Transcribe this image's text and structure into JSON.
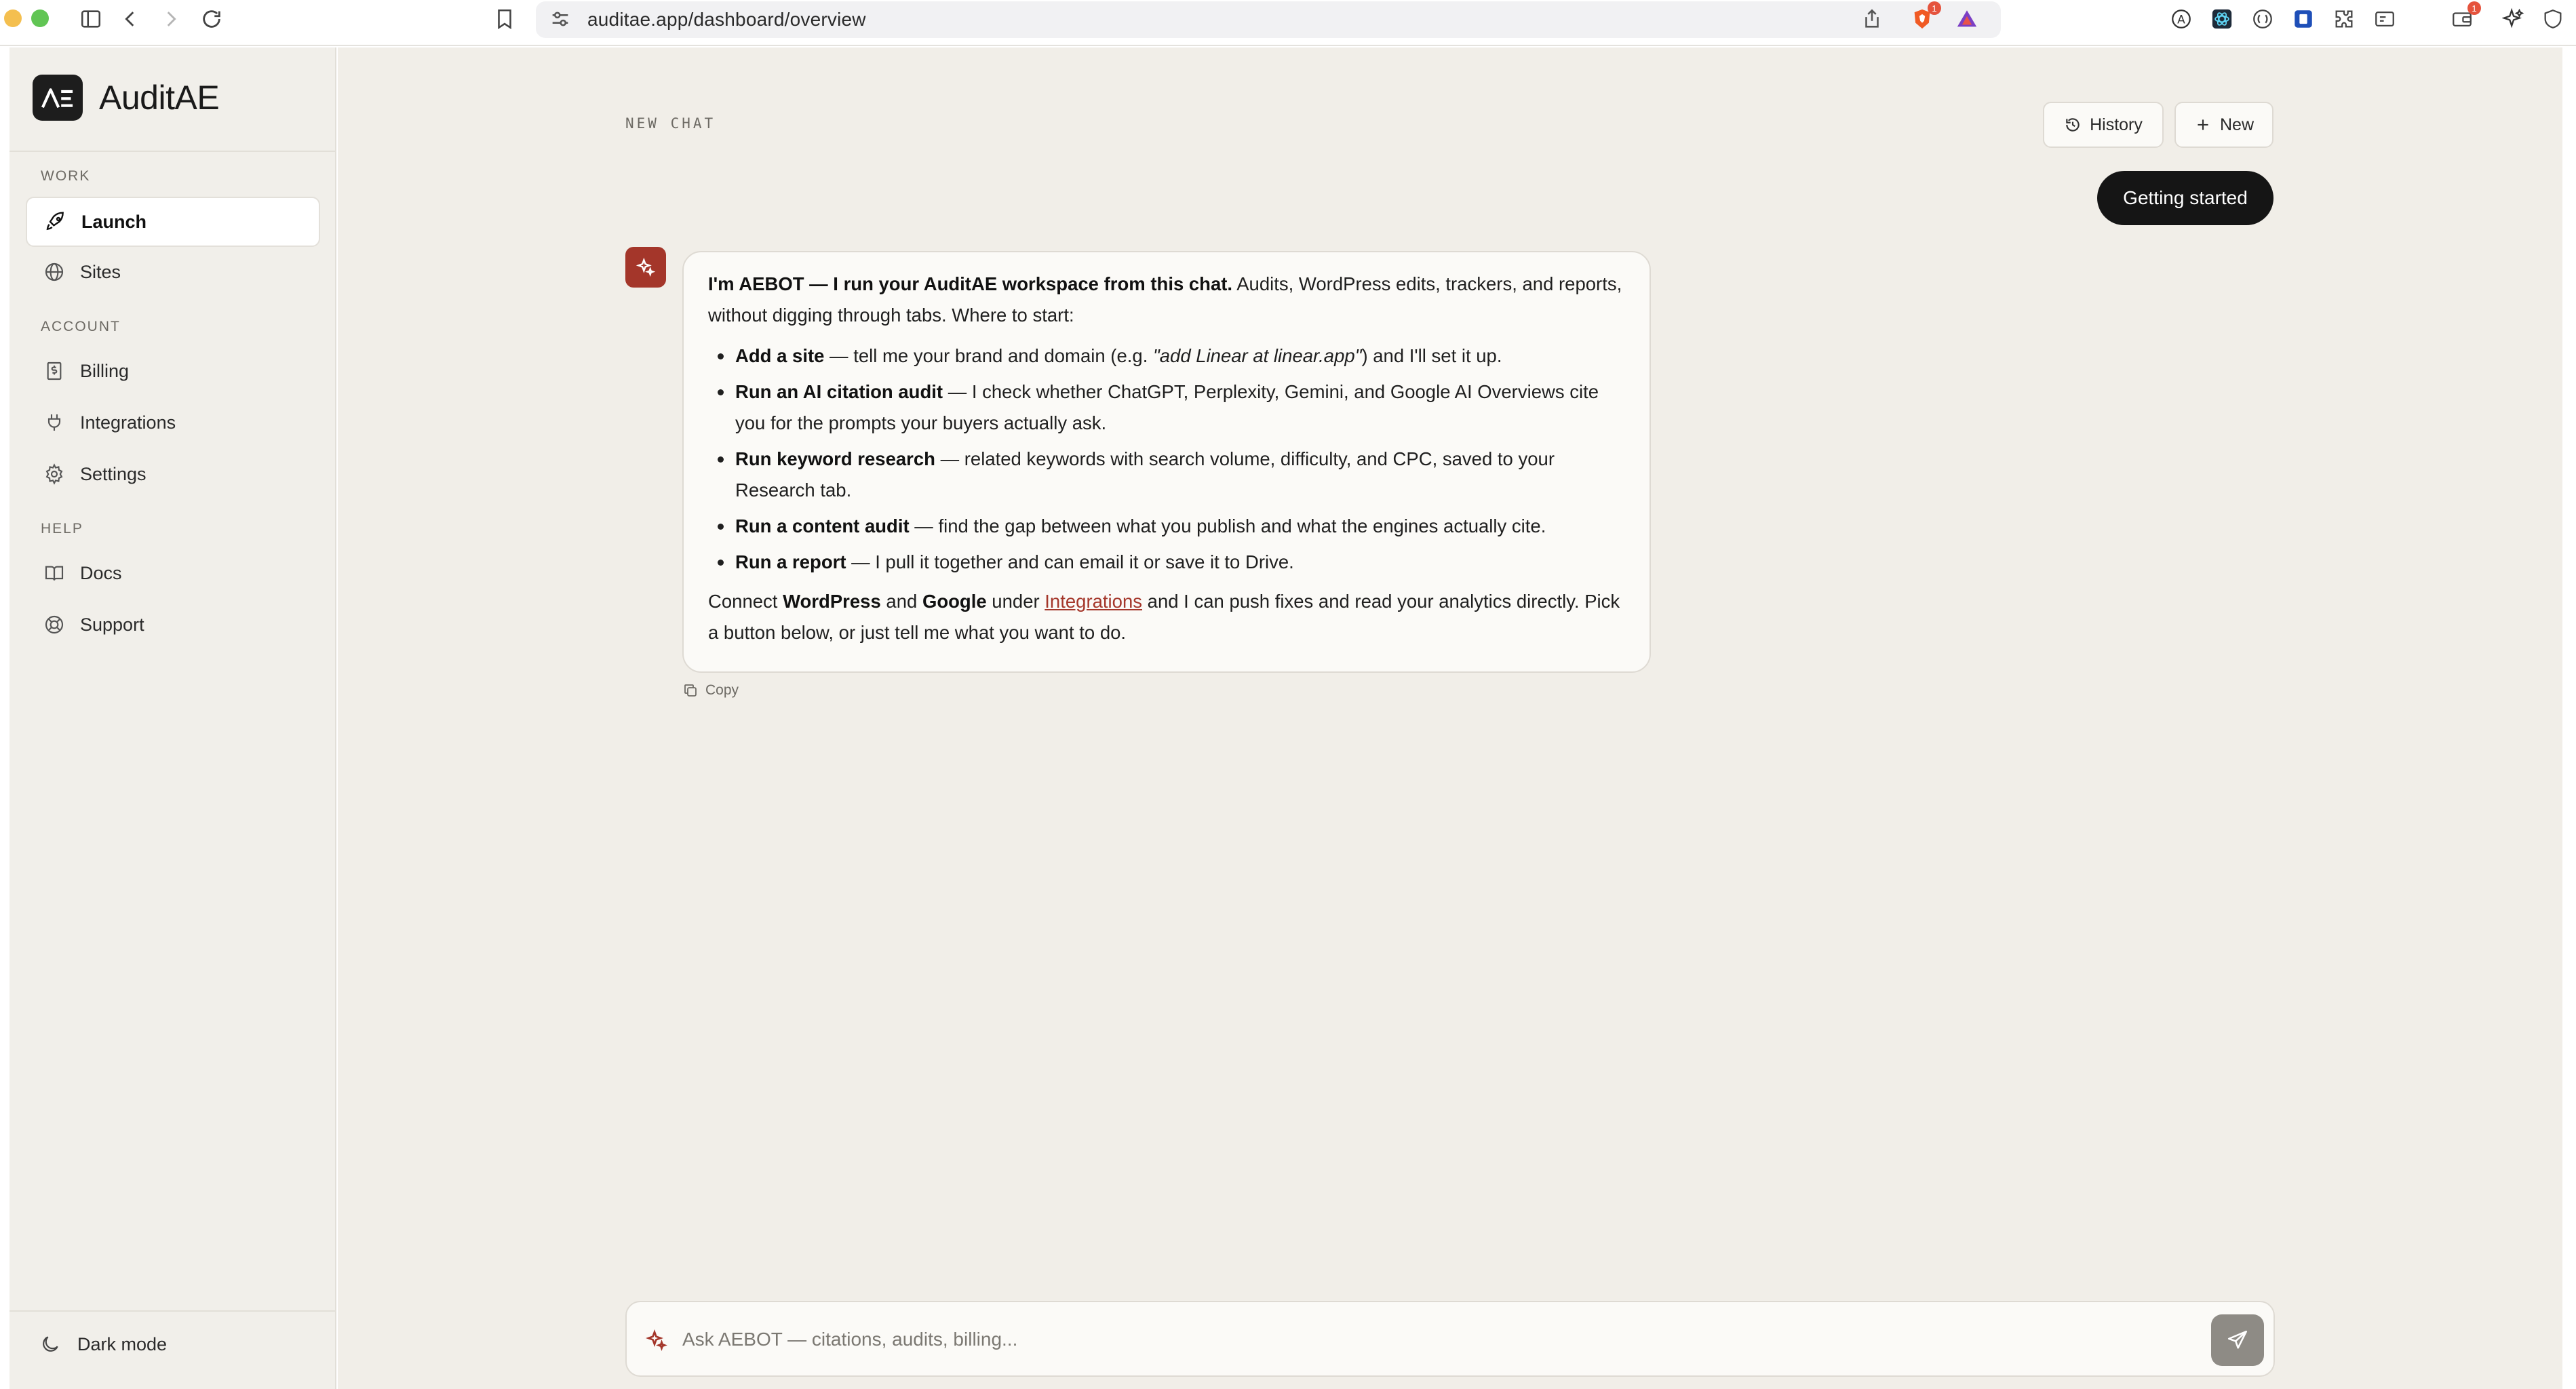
{
  "browser": {
    "url": "auditae.app/dashboard/overview",
    "brave_badge": "1",
    "wallet_badge": "1"
  },
  "sidebar": {
    "brand": "AuditAE",
    "sections": {
      "work": "WORK",
      "account": "ACCOUNT",
      "help": "HELP"
    },
    "items": {
      "launch": "Launch",
      "sites": "Sites",
      "billing": "Billing",
      "integrations": "Integrations",
      "settings": "Settings",
      "docs": "Docs",
      "support": "Support"
    },
    "dark_mode": "Dark mode"
  },
  "main": {
    "chat_label": "NEW CHAT",
    "history_label": "History",
    "new_label": "New",
    "getting_started": "Getting started",
    "message": {
      "intro_bold": "I'm AEBOT — I run your AuditAE workspace from this chat.",
      "intro_rest": " Audits, WordPress edits, trackers, and reports, without digging through tabs. Where to start:",
      "bullets": [
        {
          "bold": "Add a site",
          "pre": " — tell me your brand and domain (e.g. ",
          "italic": "\"add Linear at linear.app\"",
          "post": ") and I'll set it up."
        },
        {
          "bold": "Run an AI citation audit",
          "text": " — I check whether ChatGPT, Perplexity, Gemini, and Google AI Overviews cite you for the prompts your buyers actually ask."
        },
        {
          "bold": "Run keyword research",
          "text": " — related keywords with search volume, difficulty, and CPC, saved to your Research tab."
        },
        {
          "bold": "Run a content audit",
          "text": " — find the gap between what you publish and what the engines actually cite."
        },
        {
          "bold": "Run a report",
          "text": " — I pull it together and can email it or save it to Drive."
        }
      ],
      "closing_1": "Connect ",
      "closing_wp": "WordPress",
      "closing_2": " and ",
      "closing_google": "Google",
      "closing_3": " under ",
      "closing_link": "Integrations",
      "closing_4": " and I can push fixes and read your analytics directly. Pick a button below, or just tell me what you want to do."
    },
    "copy_label": "Copy",
    "composer_placeholder": "Ask AEBOT — citations, audits, billing..."
  },
  "colors": {
    "accent": "#a4362a",
    "sidebar_bg": "#f1efea",
    "main_bg": "#f1eee8",
    "dark_button": "#151515"
  }
}
